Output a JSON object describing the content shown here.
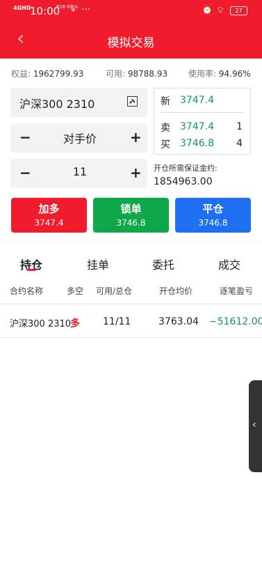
{
  "status_bar": {
    "signal": "4GHD",
    "time": "10:00",
    "speed": "816\nKB/s",
    "location_icon": "location-pin-icon",
    "more": "···",
    "alarm_icon": "alarm-clock-icon",
    "wifi_icon": "wifi-icon",
    "battery": "27"
  },
  "header": {
    "back_icon": "back-arrow-icon",
    "title": "模拟交易"
  },
  "account": {
    "equity_label": "权益:",
    "equity_value": "1962799.93",
    "available_label": "可用:",
    "available_value": "98788.93",
    "usage_label": "使用率:",
    "usage_value": "94.96%"
  },
  "order_form": {
    "contract": "沪深300 2310",
    "chart_icon": "chart-icon",
    "price_minus": "−",
    "price_type": "对手价",
    "price_plus": "+",
    "qty_minus": "−",
    "qty_value": "11",
    "qty_plus": "+",
    "margin_label": "开仓所需保证金约:",
    "margin_value": "1854963.00"
  },
  "quote": {
    "new_label": "新",
    "new_price": "3747.4",
    "sell_label": "卖",
    "sell_price": "3747.4",
    "sell_qty": "1",
    "buy_label": "买",
    "buy_price": "3746.8",
    "buy_qty": "4"
  },
  "actions": [
    {
      "title": "加多",
      "price": "3747.4",
      "color": "#f01c2d"
    },
    {
      "title": "锁单",
      "price": "3746.8",
      "color": "#0ea84b"
    },
    {
      "title": "平仓",
      "price": "3746.8",
      "color": "#1f6ff2"
    }
  ],
  "tabs": [
    "持仓",
    "挂单",
    "委托",
    "成交"
  ],
  "table": {
    "headers": [
      "合约名称",
      "多空",
      "可用/总仓",
      "开仓均价",
      "逐笔盈亏"
    ],
    "rows": [
      [
        "沪深300 2310",
        "多",
        "11/11",
        "3763.04",
        "−51612.00"
      ]
    ]
  },
  "side_handle_icon": "chevron-left-icon",
  "colors": {
    "brand": "#f01c2d",
    "profit_loss": "#129a4f",
    "lock": "#0ea84b",
    "close": "#1f6ff2"
  }
}
